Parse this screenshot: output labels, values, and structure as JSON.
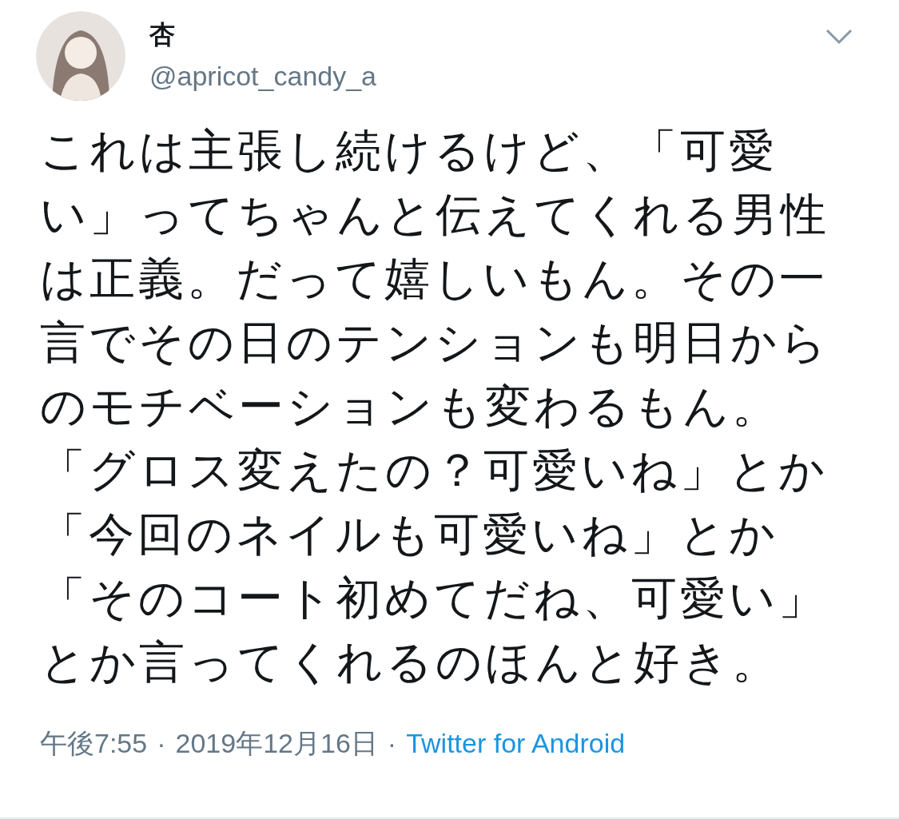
{
  "tweet": {
    "author": {
      "name": "杏",
      "handle": "@apricot_candy_a"
    },
    "text": "これは主張し続けるけど、「可愛い」ってちゃんと伝えてくれる男性は正義。だって嬉しいもん。その一言でその日のテンションも明日からのモチベーションも変わるもん。「グロス変えたの？可愛いね」とか「今回のネイルも可愛いね」とか「そのコート初めてだね、可愛い」とか言ってくれるのほんと好き。",
    "time": "午後7:55",
    "separator_1": "·",
    "date": "2019年12月16日",
    "separator_2": "·",
    "source": "Twitter for Android"
  }
}
